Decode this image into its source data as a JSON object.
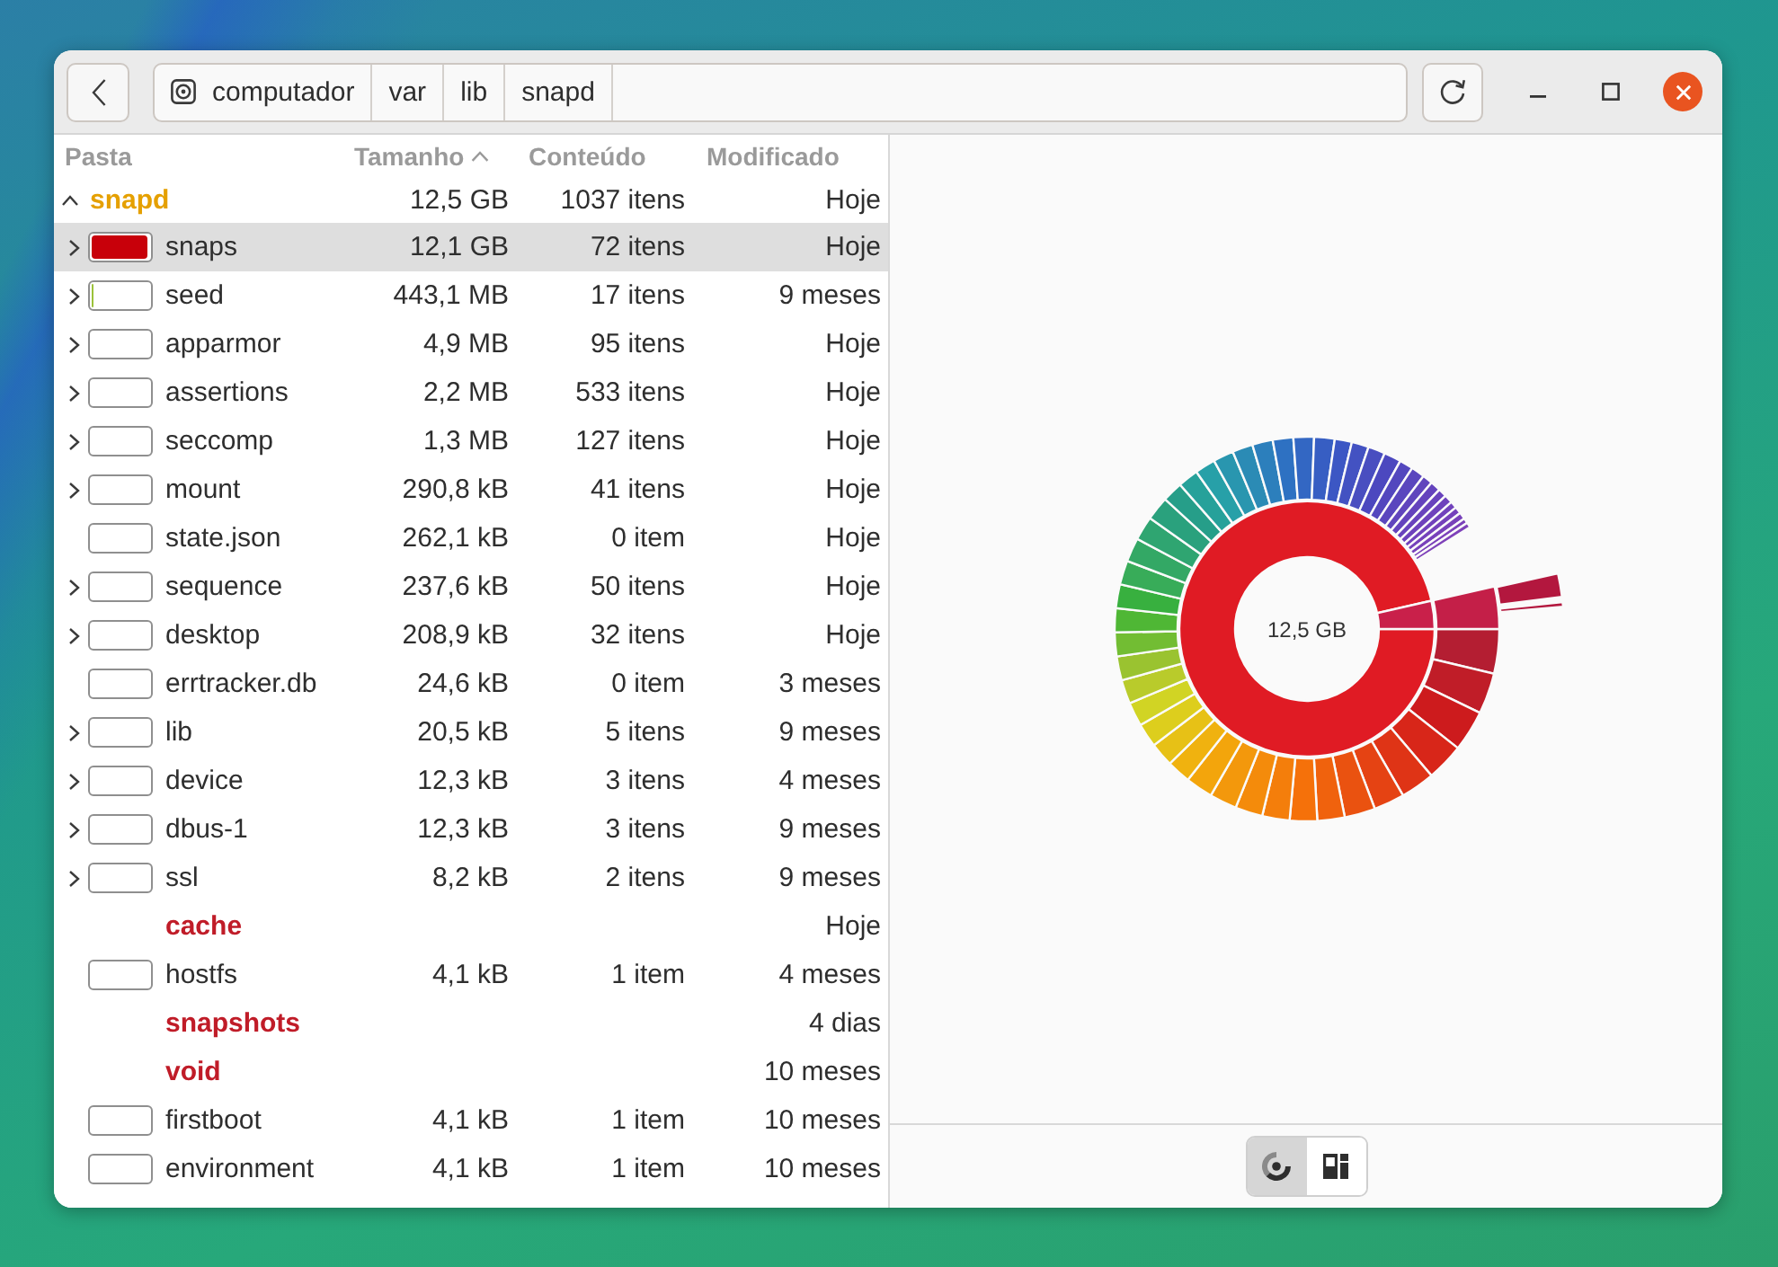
{
  "header_bar": {
    "path": [
      {
        "kind": "drive",
        "label": "computador"
      },
      {
        "kind": "folder",
        "label": "var"
      },
      {
        "kind": "folder",
        "label": "lib"
      },
      {
        "kind": "folder",
        "label": "snapd"
      }
    ]
  },
  "table": {
    "columns": [
      {
        "label": "Pasta",
        "sorted": false
      },
      {
        "label": "Tamanho",
        "sorted": true
      },
      {
        "label": "Conteúdo",
        "sorted": false
      },
      {
        "label": "Modificado",
        "sorted": false
      }
    ],
    "root": {
      "name": "snapd",
      "size": "12,5 GB",
      "contents": "1037 itens",
      "modified": "Hoje",
      "expanded": true,
      "children": [
        {
          "kind": "folder",
          "name": "snaps",
          "size": "12,1 GB",
          "contents": "72 itens",
          "modified": "Hoje",
          "level": 0.97,
          "color": "#c8000a",
          "selected": true
        },
        {
          "kind": "folder",
          "name": "seed",
          "size": "443,1 MB",
          "contents": "17 itens",
          "modified": "9 meses",
          "level": 0.035,
          "color": "#9cc23a",
          "selected": false
        },
        {
          "kind": "folder",
          "name": "apparmor",
          "size": "4,9 MB",
          "contents": "95 itens",
          "modified": "Hoje",
          "level": 0,
          "selected": false
        },
        {
          "kind": "folder",
          "name": "assertions",
          "size": "2,2 MB",
          "contents": "533 itens",
          "modified": "Hoje",
          "level": 0,
          "selected": false
        },
        {
          "kind": "folder",
          "name": "seccomp",
          "size": "1,3 MB",
          "contents": "127 itens",
          "modified": "Hoje",
          "level": 0,
          "selected": false
        },
        {
          "kind": "folder",
          "name": "mount",
          "size": "290,8 kB",
          "contents": "41 itens",
          "modified": "Hoje",
          "level": 0,
          "selected": false
        },
        {
          "kind": "file",
          "name": "state.json",
          "size": "262,1 kB",
          "contents": "0 item",
          "modified": "Hoje",
          "level": 0,
          "selected": false
        },
        {
          "kind": "folder",
          "name": "sequence",
          "size": "237,6 kB",
          "contents": "50 itens",
          "modified": "Hoje",
          "level": 0,
          "selected": false
        },
        {
          "kind": "folder",
          "name": "desktop",
          "size": "208,9 kB",
          "contents": "32 itens",
          "modified": "Hoje",
          "level": 0,
          "selected": false
        },
        {
          "kind": "file",
          "name": "errtracker.db",
          "size": "24,6 kB",
          "contents": "0 item",
          "modified": "3 meses",
          "level": 0,
          "selected": false
        },
        {
          "kind": "folder",
          "name": "lib",
          "size": "20,5 kB",
          "contents": "5 itens",
          "modified": "9 meses",
          "level": 0,
          "selected": false
        },
        {
          "kind": "folder",
          "name": "device",
          "size": "12,3 kB",
          "contents": "3 itens",
          "modified": "4 meses",
          "level": 0,
          "selected": false
        },
        {
          "kind": "folder",
          "name": "dbus-1",
          "size": "12,3 kB",
          "contents": "3 itens",
          "modified": "9 meses",
          "level": 0,
          "selected": false
        },
        {
          "kind": "folder",
          "name": "ssl",
          "size": "8,2 kB",
          "contents": "2 itens",
          "modified": "9 meses",
          "level": 0,
          "selected": false
        },
        {
          "kind": "unreadable",
          "name": "cache",
          "modified": "Hoje",
          "selected": false
        },
        {
          "kind": "file",
          "name": "hostfs",
          "size": "4,1 kB",
          "contents": "1 item",
          "modified": "4 meses",
          "level": 0,
          "selected": false
        },
        {
          "kind": "unreadable",
          "name": "snapshots",
          "modified": "4 dias",
          "selected": false
        },
        {
          "kind": "unreadable",
          "name": "void",
          "modified": "10 meses",
          "selected": false
        },
        {
          "kind": "file",
          "name": "firstboot",
          "size": "4,1 kB",
          "contents": "1 item",
          "modified": "10 meses",
          "level": 0,
          "selected": false
        },
        {
          "kind": "file",
          "name": "environment",
          "size": "4,1 kB",
          "contents": "1 item",
          "modified": "10 meses",
          "level": 0,
          "selected": false
        }
      ]
    }
  },
  "usage_chart": {
    "center_label": "12,5 GB"
  },
  "view_switcher": [
    {
      "kind": "rings",
      "selected": true
    },
    {
      "kind": "treemap",
      "selected": false
    }
  ]
}
